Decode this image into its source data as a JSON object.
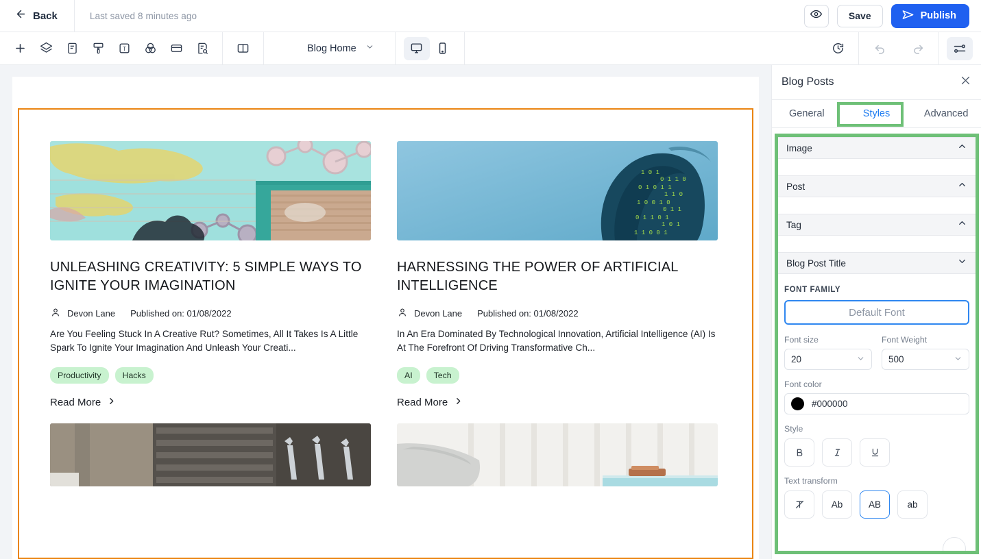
{
  "topbar": {
    "back_label": "Back",
    "saved_text": "Last saved 8 minutes ago",
    "preview_icon": "eye-icon",
    "save_label": "Save",
    "publish_label": "Publish",
    "publish_icon": "send-icon",
    "publish_color": "#1f60f0"
  },
  "toolbar": {
    "icons": [
      {
        "name": "add-icon",
        "label": "+"
      },
      {
        "name": "layers-icon",
        "label": "Layers"
      },
      {
        "name": "page-icon",
        "label": "Pages"
      },
      {
        "name": "brush-icon",
        "label": "Theme"
      },
      {
        "name": "text-icon",
        "label": "Text"
      },
      {
        "name": "color-icon",
        "label": "Colors"
      },
      {
        "name": "section-icon",
        "label": "Sections"
      },
      {
        "name": "seo-icon",
        "label": "SEO"
      },
      {
        "name": "panel-icon",
        "label": "Panel"
      }
    ],
    "page_select_label": "Blog Home",
    "device_desktop": "desktop-icon",
    "device_mobile": "mobile-icon",
    "history_icon": "history-icon",
    "undo_icon": "undo-icon",
    "redo_icon": "redo-icon",
    "settings_icon": "sliders-icon"
  },
  "canvas": {
    "selection_color": "#ea8412",
    "posts": [
      {
        "title": "UNLEASHING CREATIVITY: 5 SIMPLE WAYS TO IGNITE YOUR IMAGINATION",
        "author": "Devon Lane",
        "published": "Published on: 01/08/2022",
        "excerpt": "Are You Feeling Stuck In A Creative Rut? Sometimes, All It Takes Is A Little Spark To Ignite Your Imagination And Unleash Your Creati...",
        "tags": [
          "Productivity",
          "Hacks"
        ],
        "read_more": "Read More"
      },
      {
        "title": "HARNESSING THE POWER OF ARTIFICIAL INTELLIGENCE",
        "author": "Devon Lane",
        "published": "Published on: 01/08/2022",
        "excerpt": "In An Era Dominated By Technological Innovation, Artificial Intelligence (AI) Is At The Forefront Of Driving Transformative Ch...",
        "tags": [
          "AI",
          "Tech"
        ],
        "read_more": "Read More"
      }
    ]
  },
  "panel": {
    "title": "Blog Posts",
    "close_icon": "close-icon",
    "highlight_color": "#6ec077",
    "tabs": [
      {
        "label": "General",
        "active": false
      },
      {
        "label": "Styles",
        "active": true
      },
      {
        "label": "Advanced",
        "active": false
      }
    ],
    "sections": [
      {
        "label": "Image",
        "expanded": true
      },
      {
        "label": "Post",
        "expanded": true
      },
      {
        "label": "Tag",
        "expanded": true
      },
      {
        "label": "Blog Post Title",
        "expanded": false
      }
    ],
    "font_family_label": "FONT FAMILY",
    "font_family_value": "Default Font",
    "font_size_label": "Font size",
    "font_size_value": "20",
    "font_weight_label": "Font Weight",
    "font_weight_value": "500",
    "font_color_label": "Font color",
    "font_color_value": "#000000",
    "style_label": "Style",
    "style_buttons": [
      {
        "name": "bold-button",
        "label": "B",
        "selected": false
      },
      {
        "name": "italic-button",
        "label": "I",
        "selected": false
      },
      {
        "name": "underline-button",
        "label": "U",
        "selected": false
      }
    ],
    "text_transform_label": "Text transform",
    "text_transform_buttons": [
      {
        "name": "transform-none-button",
        "label": "",
        "selected": false
      },
      {
        "name": "transform-capitalize-button",
        "label": "Ab",
        "selected": false
      },
      {
        "name": "transform-uppercase-button",
        "label": "AB",
        "selected": true
      },
      {
        "name": "transform-lowercase-button",
        "label": "ab",
        "selected": false
      }
    ]
  }
}
